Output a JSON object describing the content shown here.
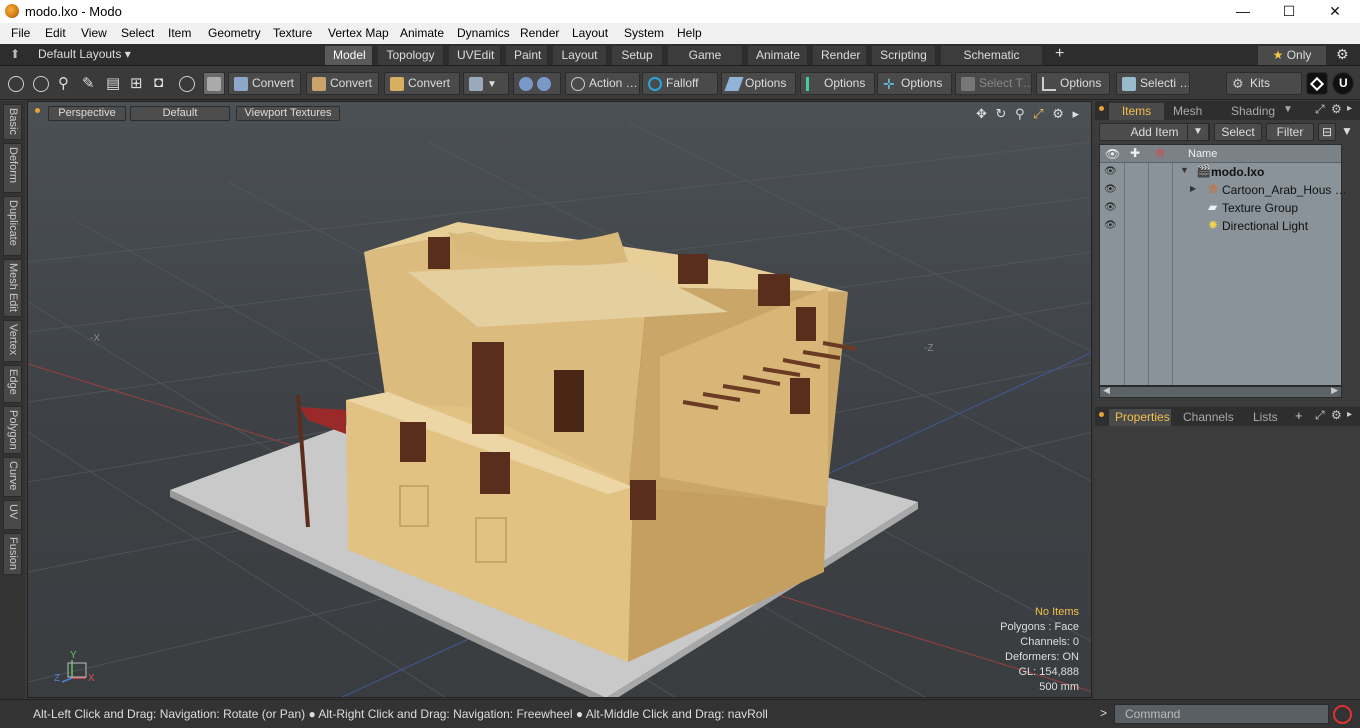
{
  "window": {
    "title": "modo.lxo - Modo",
    "minimize": "—",
    "maximize": "☐",
    "close": "✕"
  },
  "menu": [
    "File",
    "Edit",
    "View",
    "Select",
    "Item",
    "Geometry",
    "Texture",
    "Vertex Map",
    "Animate",
    "Dynamics",
    "Render",
    "Layout",
    "System",
    "Help"
  ],
  "layout_selector": "Default Layouts ▾",
  "tabs": [
    "Model",
    "Topology",
    "UVEdit",
    "Paint",
    "Layout",
    "Setup",
    "Game Tools",
    "Animate",
    "Render",
    "Scripting",
    "Schematic Fusion"
  ],
  "active_tab": "Model",
  "tab_add": "+",
  "only_label": "Only",
  "toolbar": {
    "convert1": "Convert",
    "convert2": "Convert",
    "convert3": "Convert",
    "action": "Action",
    "action_more": "…",
    "falloff": "Falloff",
    "options1": "Options",
    "options2": "Options",
    "options3": "Options",
    "select_t": "Select T…",
    "options4": "Options",
    "selecti": "Selecti …",
    "kits": "Kits"
  },
  "vtabs": [
    "Basic",
    "Deform",
    "Duplicate",
    "Mesh Edit",
    "Vertex",
    "Edge",
    "Polygon",
    "Curve",
    "UV",
    "Fusion"
  ],
  "viewport": {
    "view_mode": "Perspective",
    "shading": "Default",
    "textures": "Viewport Textures",
    "axis_minus_x": "-X",
    "axis_minus_z": "-Z",
    "info": {
      "selection": "No Items",
      "polygons": "Polygons : Face",
      "channels": "Channels: 0",
      "deformers": "Deformers: ON",
      "gl": "GL: 154,888",
      "scale": "500 mm"
    },
    "gizmo": {
      "y": "Y",
      "z": "Z",
      "x": "X"
    }
  },
  "items_panel": {
    "tabs": [
      "Items",
      "Mesh …",
      "Shading"
    ],
    "add_item": "Add Item",
    "select": "Select",
    "filter": "Filter",
    "column_name": "Name",
    "rows": [
      {
        "label": "modo.lxo"
      },
      {
        "label": "Cartoon_Arab_Hous …"
      },
      {
        "label": "Texture Group"
      },
      {
        "label": "Directional Light"
      }
    ]
  },
  "properties_panel": {
    "tabs": [
      "Properties",
      "Channels",
      "Lists"
    ],
    "add": "+"
  },
  "status": {
    "hint": "Alt-Left Click and Drag: Navigation: Rotate (or Pan) ● Alt-Right Click and Drag: Navigation: Freewheel ● Alt-Middle Click and Drag: navRoll",
    "prompt": ">",
    "command_placeholder": "Command"
  },
  "colors": {
    "accent": "#f2c04a",
    "wall": "#e1c183",
    "ground": "#cfcfcf",
    "wood": "#5a2e1c"
  }
}
